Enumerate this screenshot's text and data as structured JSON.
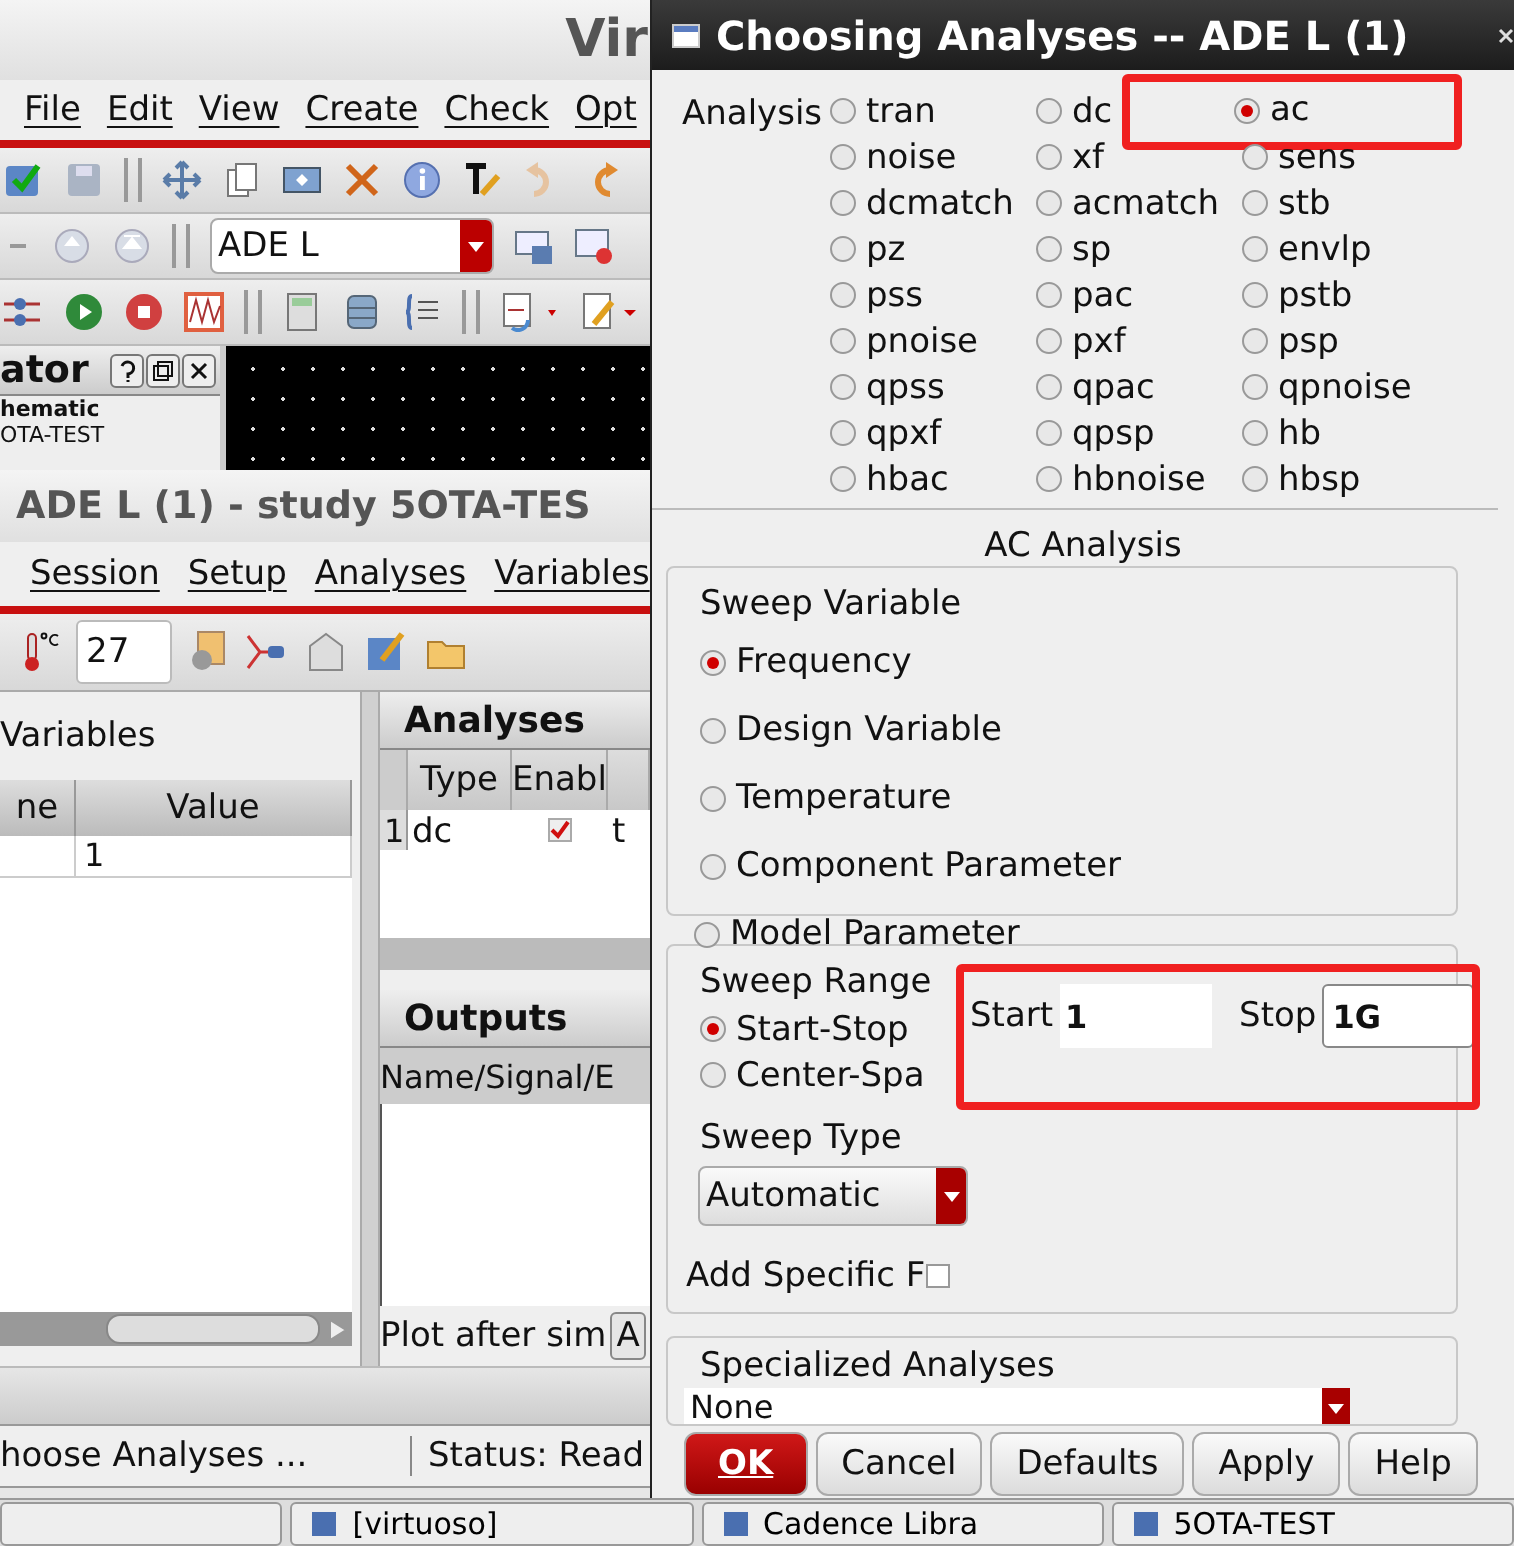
{
  "ade_window": {
    "title": "Vir",
    "menu": [
      "File",
      "Edit",
      "View",
      "Create",
      "Check",
      "Opt"
    ],
    "combo_value": "ADE L",
    "navigator": {
      "title": "ator",
      "lines": [
        "hematic",
        "OTA-TEST"
      ]
    },
    "session_title": "ADE L (1) - study 5OTA-TES",
    "session_menu": [
      "Session",
      "Setup",
      "Analyses",
      "Variables"
    ],
    "temperature": "27",
    "variables": {
      "title": "Variables",
      "columns": [
        "ne",
        "Value"
      ],
      "rows": [
        {
          "value": "1"
        }
      ]
    },
    "analyses": {
      "title": "Analyses",
      "columns": [
        "Type",
        "Enabl"
      ],
      "rows": [
        {
          "index": "1",
          "type": "dc",
          "enabled": true,
          "column_3": "t"
        }
      ]
    },
    "outputs": {
      "title": "Outputs",
      "columns": [
        "Name/Signal/E"
      ]
    },
    "plot_after": {
      "label": "Plot after sim",
      "button": "A"
    },
    "status_bar": [
      "hoose Analyses ...",
      "Status: Read"
    ]
  },
  "taskbar": [
    "[virtuoso]",
    "Cadence Libra",
    "5OTA-TEST"
  ],
  "dialog": {
    "title": "Choosing Analyses -- ADE L (1)",
    "analysis_label": "Analysis",
    "analyses": [
      {
        "label": "tran",
        "selected": false,
        "highlighted": false
      },
      {
        "label": "dc",
        "selected": false,
        "highlighted": false
      },
      {
        "label": "ac",
        "selected": true,
        "highlighted": true
      },
      {
        "label": "noise",
        "selected": false,
        "highlighted": false
      },
      {
        "label": "xf",
        "selected": false,
        "highlighted": false
      },
      {
        "label": "sens",
        "selected": false,
        "highlighted": false
      },
      {
        "label": "dcmatch",
        "selected": false,
        "highlighted": false
      },
      {
        "label": "acmatch",
        "selected": false,
        "highlighted": false
      },
      {
        "label": "stb",
        "selected": false,
        "highlighted": false
      },
      {
        "label": "pz",
        "selected": false,
        "highlighted": false
      },
      {
        "label": "sp",
        "selected": false,
        "highlighted": false
      },
      {
        "label": "envlp",
        "selected": false,
        "highlighted": false
      },
      {
        "label": "pss",
        "selected": false,
        "highlighted": false
      },
      {
        "label": "pac",
        "selected": false,
        "highlighted": false
      },
      {
        "label": "pstb",
        "selected": false,
        "highlighted": false
      },
      {
        "label": "pnoise",
        "selected": false,
        "highlighted": false
      },
      {
        "label": "pxf",
        "selected": false,
        "highlighted": false
      },
      {
        "label": "psp",
        "selected": false,
        "highlighted": false
      },
      {
        "label": "qpss",
        "selected": false,
        "highlighted": false
      },
      {
        "label": "qpac",
        "selected": false,
        "highlighted": false
      },
      {
        "label": "qpnoise",
        "selected": false,
        "highlighted": false
      },
      {
        "label": "qpxf",
        "selected": false,
        "highlighted": false
      },
      {
        "label": "qpsp",
        "selected": false,
        "highlighted": false
      },
      {
        "label": "hb",
        "selected": false,
        "highlighted": false
      },
      {
        "label": "hbac",
        "selected": false,
        "highlighted": false
      },
      {
        "label": "hbnoise",
        "selected": false,
        "highlighted": false
      },
      {
        "label": "hbsp",
        "selected": false,
        "highlighted": false
      }
    ],
    "section_title": "AC Analysis",
    "sweep_variable": {
      "title": "Sweep Variable",
      "options": [
        {
          "label": "Frequency",
          "selected": true
        },
        {
          "label": "Design Variable",
          "selected": false
        },
        {
          "label": "Temperature",
          "selected": false
        },
        {
          "label": "Component Parameter",
          "selected": false
        },
        {
          "label": "Model Parameter",
          "selected": false
        }
      ]
    },
    "sweep_range": {
      "title": "Sweep Range",
      "options": [
        {
          "label": "Start-Stop",
          "selected": true
        },
        {
          "label": "Center-Spa",
          "selected": false
        }
      ],
      "highlighted": true,
      "start": {
        "label": "Start",
        "value": "1"
      },
      "stop": {
        "label": "Stop",
        "value": "1G"
      }
    },
    "sweep_type": {
      "title": "Sweep Type",
      "value": "Automatic"
    },
    "add_specific": {
      "label": "Add Specific F",
      "checked": false
    },
    "specialized": {
      "title": "Specialized Analyses",
      "value": "None"
    },
    "buttons": [
      {
        "label": "OK",
        "kind": "default"
      },
      {
        "label": "Cancel",
        "kind": "normal"
      },
      {
        "label": "Defaults",
        "kind": "normal"
      },
      {
        "label": "Apply",
        "kind": "normal"
      },
      {
        "label": "Help",
        "kind": "normal"
      }
    ]
  }
}
